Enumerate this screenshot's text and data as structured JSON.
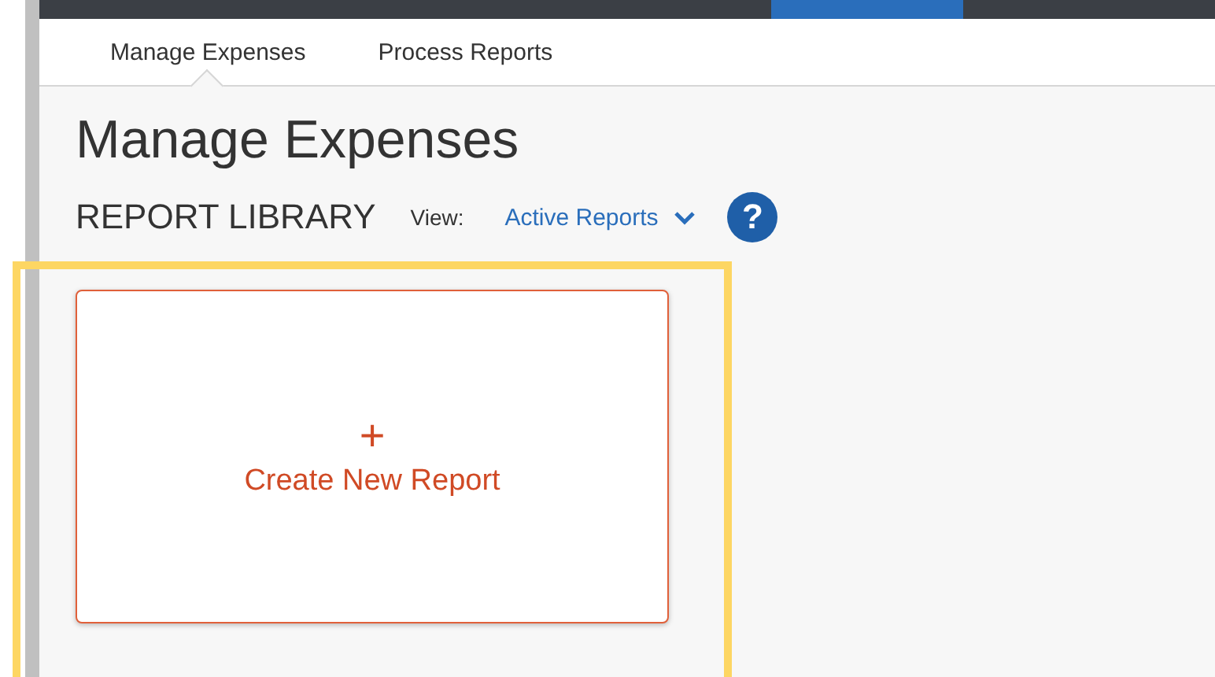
{
  "tabs": [
    {
      "label": "Manage Expenses",
      "selected": true
    },
    {
      "label": "Process Reports",
      "selected": false
    }
  ],
  "page_title": "Manage Expenses",
  "library": {
    "title": "REPORT LIBRARY",
    "view_label": "View:",
    "view_value": "Active Reports",
    "help": "?"
  },
  "create_card": {
    "symbol": "+",
    "label": "Create New Report"
  },
  "highlight": {
    "shown": true
  }
}
